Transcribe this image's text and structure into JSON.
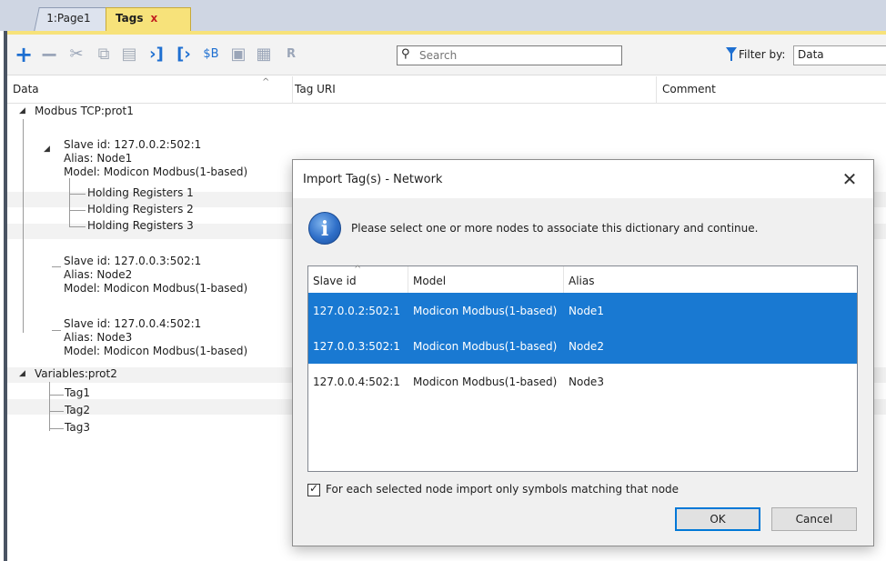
{
  "tabs": [
    {
      "label": "1:Page1"
    },
    {
      "label": "Tags",
      "close": "x"
    }
  ],
  "toolbar": {
    "icons": [
      "add-icon",
      "remove-icon",
      "cut-icon",
      "copy-icon",
      "paste-icon",
      "import-icon",
      "export-icon",
      "rename-icon",
      "tag-icon",
      "group-icon",
      "r-icon"
    ],
    "search_placeholder": "Search",
    "filter_label": "Filter by:",
    "filter_value": "Data"
  },
  "columns": {
    "data": "Data",
    "uri": "Tag URI",
    "comment": "Comment"
  },
  "tree": {
    "prot1": "Modbus TCP:prot1",
    "slave1": {
      "id": "Slave id: 127.0.0.2:502:1",
      "alias": "Alias: Node1",
      "model": "Model: Modicon Modbus(1-based)"
    },
    "registers": [
      "Holding Registers 1",
      "Holding Registers 2",
      "Holding Registers 3"
    ],
    "slave2": {
      "id": "Slave id: 127.0.0.3:502:1",
      "alias": "Alias: Node2",
      "model": "Model: Modicon Modbus(1-based)"
    },
    "slave3": {
      "id": "Slave id: 127.0.0.4:502:1",
      "alias": "Alias: Node3",
      "model": "Model: Modicon Modbus(1-based)"
    },
    "prot2": "Variables:prot2",
    "tags": [
      "Tag1",
      "Tag2",
      "Tag3"
    ]
  },
  "dialog": {
    "title": "Import Tag(s) - Network",
    "message": "Please select one or more nodes to associate this dictionary and continue.",
    "headers": {
      "slave": "Slave id",
      "model": "Model",
      "alias": "Alias"
    },
    "rows": [
      {
        "slave": "127.0.0.2:502:1",
        "model": "Modicon Modbus(1-based)",
        "alias": "Node1",
        "selected": true
      },
      {
        "slave": "127.0.0.3:502:1",
        "model": "Modicon Modbus(1-based)",
        "alias": "Node2",
        "selected": true
      },
      {
        "slave": "127.0.0.4:502:1",
        "model": "Modicon Modbus(1-based)",
        "alias": "Node3",
        "selected": false
      }
    ],
    "checkbox_label": "For each selected node import only symbols matching that node",
    "checkbox_checked": true,
    "ok_label": "OK",
    "cancel_label": "Cancel"
  },
  "colors": {
    "accent": "#1979d2",
    "tab_active": "#f7e27a",
    "toolbar_icon": "#1e6fd1"
  }
}
